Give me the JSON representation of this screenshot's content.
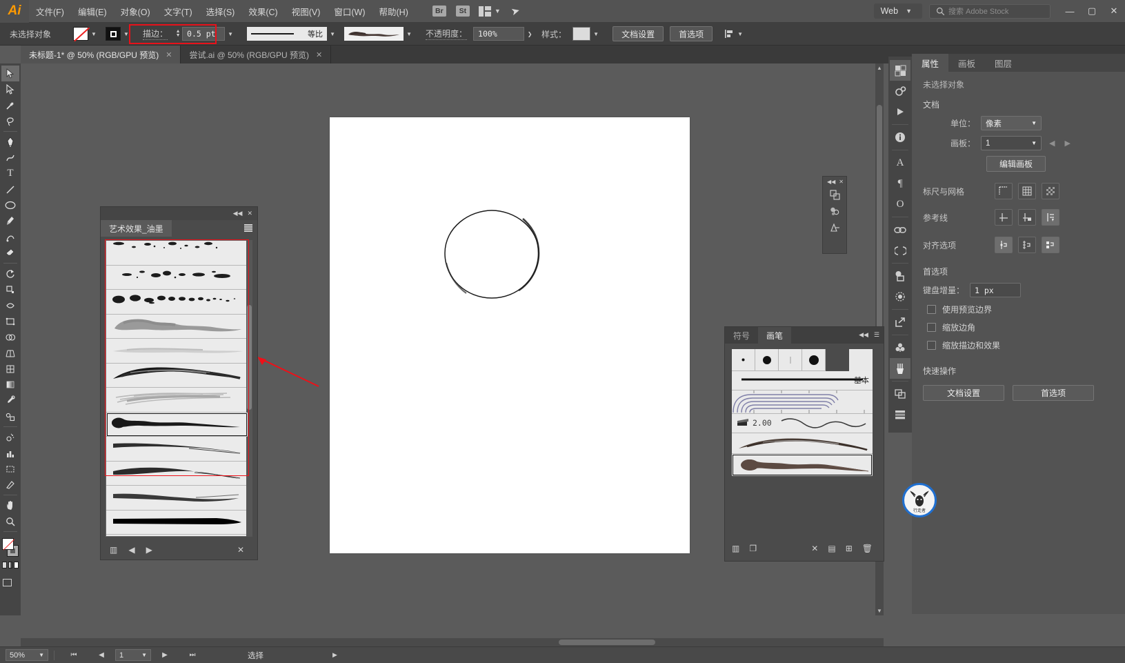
{
  "app": {
    "logo": "Ai",
    "menus": [
      "文件(F)",
      "编辑(E)",
      "对象(O)",
      "文字(T)",
      "选择(S)",
      "效果(C)",
      "视图(V)",
      "窗口(W)",
      "帮助(H)"
    ],
    "quick_icons": [
      "Br",
      "St"
    ],
    "arrange_icon": "arrange-documents-icon",
    "rocket_icon": "discover-icon",
    "workspace": "Web",
    "stock_search_placeholder": "搜索 Adobe Stock",
    "window_buttons": {
      "minimize": "—",
      "maximize": "▢",
      "close": "✕"
    }
  },
  "control_bar": {
    "selection_status": "未选择对象",
    "fill_label": "fill-swatch",
    "stroke_swatch_label": "stroke-swatch",
    "stroke_label": "描边：",
    "stroke_weight": "0.5 pt",
    "profile_label": "等比",
    "brush_label": "brush-preview",
    "opacity_label": "不透明度：",
    "opacity_value": "100%",
    "style_label": "样式：",
    "doc_setup_button": "文档设置",
    "preferences_button": "首选项",
    "align_icon": "align-objects-icon"
  },
  "tabs": [
    {
      "title": "未标题-1* @ 50% (RGB/GPU 预览)",
      "active": true,
      "close": "✕"
    },
    {
      "title": "尝试.ai @ 50% (RGB/GPU 预览)",
      "active": false,
      "close": "✕"
    }
  ],
  "toolbar": {
    "tools": [
      "selection-tool",
      "direct-selection-tool",
      "magic-wand-tool",
      "lasso-tool",
      "pen-tool",
      "curvature-tool",
      "type-tool",
      "line-segment-tool",
      "ellipse-tool",
      "paintbrush-tool",
      "shaper-tool",
      "eraser-tool",
      "rotate-tool",
      "scale-tool",
      "width-tool",
      "free-transform-tool",
      "shape-builder-tool",
      "perspective-grid-tool",
      "mesh-tool",
      "gradient-tool",
      "eyedropper-tool",
      "blend-tool",
      "symbol-sprayer-tool",
      "column-graph-tool",
      "artboard-tool",
      "slice-tool",
      "hand-tool",
      "zoom-tool"
    ],
    "fill_stroke": "fill-and-stroke-indicator",
    "screen_mode": "change-screen-mode"
  },
  "ink_panel": {
    "title": "艺术效果_油墨",
    "collapse_icon": "collapse-icon",
    "close_icon": "close-icon",
    "menu_icon": "panel-menu-icon",
    "brushes": [
      {
        "name": "ink-splatter-1",
        "kind": "splatter",
        "selected": false
      },
      {
        "name": "ink-splatter-2",
        "kind": "splatter2",
        "selected": false
      },
      {
        "name": "ink-dots",
        "kind": "dots",
        "selected": false
      },
      {
        "name": "ink-wash-gray",
        "kind": "wash",
        "selected": false
      },
      {
        "name": "ink-faint-wash",
        "kind": "faint",
        "selected": false
      },
      {
        "name": "ink-dry-brush-dark",
        "kind": "dry-dark",
        "selected": false
      },
      {
        "name": "ink-dry-brush-light",
        "kind": "dry-light",
        "selected": false
      },
      {
        "name": "ink-tapered-blob",
        "kind": "blob",
        "selected": true
      },
      {
        "name": "ink-stroke-1",
        "kind": "stroke1",
        "selected": false
      },
      {
        "name": "ink-stroke-2",
        "kind": "stroke2",
        "selected": false
      },
      {
        "name": "ink-stroke-3",
        "kind": "stroke3",
        "selected": false
      },
      {
        "name": "ink-solid-taper-1",
        "kind": "solid1",
        "selected": false
      },
      {
        "name": "ink-solid-taper-2",
        "kind": "solid2",
        "selected": false
      },
      {
        "name": "ink-solid-taper-3",
        "kind": "solid3",
        "selected": false
      }
    ],
    "footer": {
      "library_icon": "brush-libraries-icon",
      "prev_icon": "previous-icon",
      "next_icon": "next-icon",
      "delete_icon": "delete-icon"
    }
  },
  "mini_dock": {
    "collapse_icon": "collapse-icon",
    "close_icon": "close-icon",
    "icons": [
      "transform-icon",
      "color-guide-icon",
      "swatches-icon",
      "gradient-icon"
    ]
  },
  "brushes_panel": {
    "tabs": [
      {
        "label": "符号",
        "active": false
      },
      {
        "label": "画笔",
        "active": true
      }
    ],
    "collapse_icon": "collapse-icon",
    "menu_icon": "panel-menu-icon",
    "calligraphic": [
      "dot-small",
      "dot-large",
      "dot-tiny",
      "dot-xl"
    ],
    "rows": [
      {
        "name": "basic-brush",
        "kind": "basic",
        "label": "基本",
        "selected": false
      },
      {
        "name": "pattern-brush",
        "kind": "pattern",
        "label": "",
        "selected": false
      },
      {
        "name": "bristle-brush",
        "kind": "bristle",
        "label": "2.00",
        "selected": false
      },
      {
        "name": "art-brush-rough",
        "kind": "rough",
        "label": "",
        "selected": false
      },
      {
        "name": "art-brush-ink-blob",
        "kind": "inkblob",
        "label": "",
        "selected": true
      }
    ],
    "footer": {
      "library_icon": "brush-libraries-icon",
      "remove_link_icon": "remove-brush-stroke-icon",
      "options_icon": "options-of-selected-object-icon",
      "new_icon": "new-brush-icon",
      "delete_icon": "delete-brush-icon"
    }
  },
  "rail": {
    "icons": [
      "properties-icon",
      "gear-icon",
      "play-icon",
      "info-icon",
      "character-icon",
      "paragraph-icon",
      "glyph-icon",
      "links-icon",
      "cc-libraries-icon",
      "pathfinder-icon",
      "transparency-icon",
      "export-icon",
      "symbols-icon",
      "brushes-icon",
      "artboards-icon",
      "layers-icon"
    ]
  },
  "properties": {
    "tabs": [
      {
        "label": "属性",
        "active": true
      },
      {
        "label": "画板",
        "active": false
      },
      {
        "label": "图层",
        "active": false
      }
    ],
    "status": "未选择对象",
    "document_section": "文档",
    "unit_label": "单位：",
    "unit_value": "像素",
    "artboard_label": "画板：",
    "artboard_value": "1",
    "edit_artboards_button": "编辑画板",
    "ruler_grid_label": "标尺与网格",
    "ruler_icons": [
      "show-rulers-icon",
      "show-grid-icon",
      "show-transparency-grid-icon"
    ],
    "guides_label": "参考线",
    "guide_icons": [
      "show-guides-icon",
      "lock-guides-icon",
      "smart-guides-icon"
    ],
    "snap_label": "对齐选项",
    "snap_icons": [
      "snap-to-point-icon",
      "snap-to-grid-icon",
      "snap-to-pixel-icon"
    ],
    "prefs_section": "首选项",
    "keyboard_increment_label": "键盘增量：",
    "keyboard_increment_value": "1 px",
    "checkboxes": [
      {
        "label": "使用预览边界",
        "checked": false
      },
      {
        "label": "缩放边角",
        "checked": false
      },
      {
        "label": "缩放描边和效果",
        "checked": false
      }
    ],
    "quick_actions_label": "快速操作",
    "quick_actions": [
      "文档设置",
      "首选项"
    ]
  },
  "badge": {
    "text": "行走者"
  },
  "status_bar": {
    "zoom": "50%",
    "page": "1",
    "tool_status": "选择",
    "nav_first": "⏮",
    "nav_prev": "◀",
    "nav_next": "▶",
    "nav_last": "⏭"
  },
  "colors": {
    "accent_red": "#ee1018",
    "orange": "#ff9a00",
    "panel_bg": "#535353",
    "canvas_bg": "#5b5b5b",
    "artboard": "#ffffff"
  }
}
